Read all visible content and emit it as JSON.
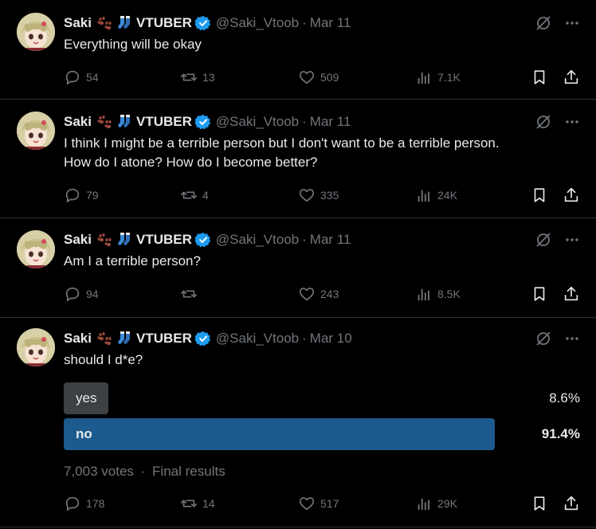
{
  "author": {
    "name": "Saki",
    "suffix": "VTUBER",
    "handle": "@Saki_Vtoob",
    "separator": "·"
  },
  "colors": {
    "background": "#000000",
    "text": "#e7e9ea",
    "muted": "#71767b",
    "divider": "#2f3336",
    "verified": "#1d9bf0",
    "poll_winner": "#1d5b8f",
    "poll_other": "#3e4144"
  },
  "icons": {
    "emoji_1": "paw-prints-icon",
    "emoji_2": "socks-icon",
    "verified": "verified-badge-icon",
    "grok": "grok-icon",
    "more": "more-dots-icon",
    "reply": "reply-icon",
    "retweet": "retweet-icon",
    "like": "heart-icon",
    "views": "views-icon",
    "bookmark": "bookmark-icon",
    "share": "share-icon"
  },
  "tweets": [
    {
      "date": "Mar 11",
      "lines": [
        "Everything will be okay"
      ],
      "replies": "54",
      "retweets": "13",
      "likes": "509",
      "views": "7.1K"
    },
    {
      "date": "Mar 11",
      "lines": [
        "I think I might be a terrible person but I don't want to be a terrible person.",
        "How do I atone? How do I become better?"
      ],
      "replies": "79",
      "retweets": "4",
      "likes": "335",
      "views": "24K"
    },
    {
      "date": "Mar 11",
      "lines": [
        "Am I a terrible person?"
      ],
      "replies": "94",
      "retweets": "",
      "likes": "243",
      "views": "8.5K"
    },
    {
      "date": "Mar 10",
      "lines": [
        "should I d*e?"
      ],
      "replies": "178",
      "retweets": "14",
      "likes": "517",
      "views": "29K",
      "poll": {
        "options": [
          {
            "label": "yes",
            "percent_label": "8.6%",
            "percent": 8.6,
            "winner": false
          },
          {
            "label": "no",
            "percent_label": "91.4%",
            "percent": 91.4,
            "winner": true
          }
        ],
        "votes": "7,003 votes",
        "status": "Final results"
      }
    }
  ]
}
